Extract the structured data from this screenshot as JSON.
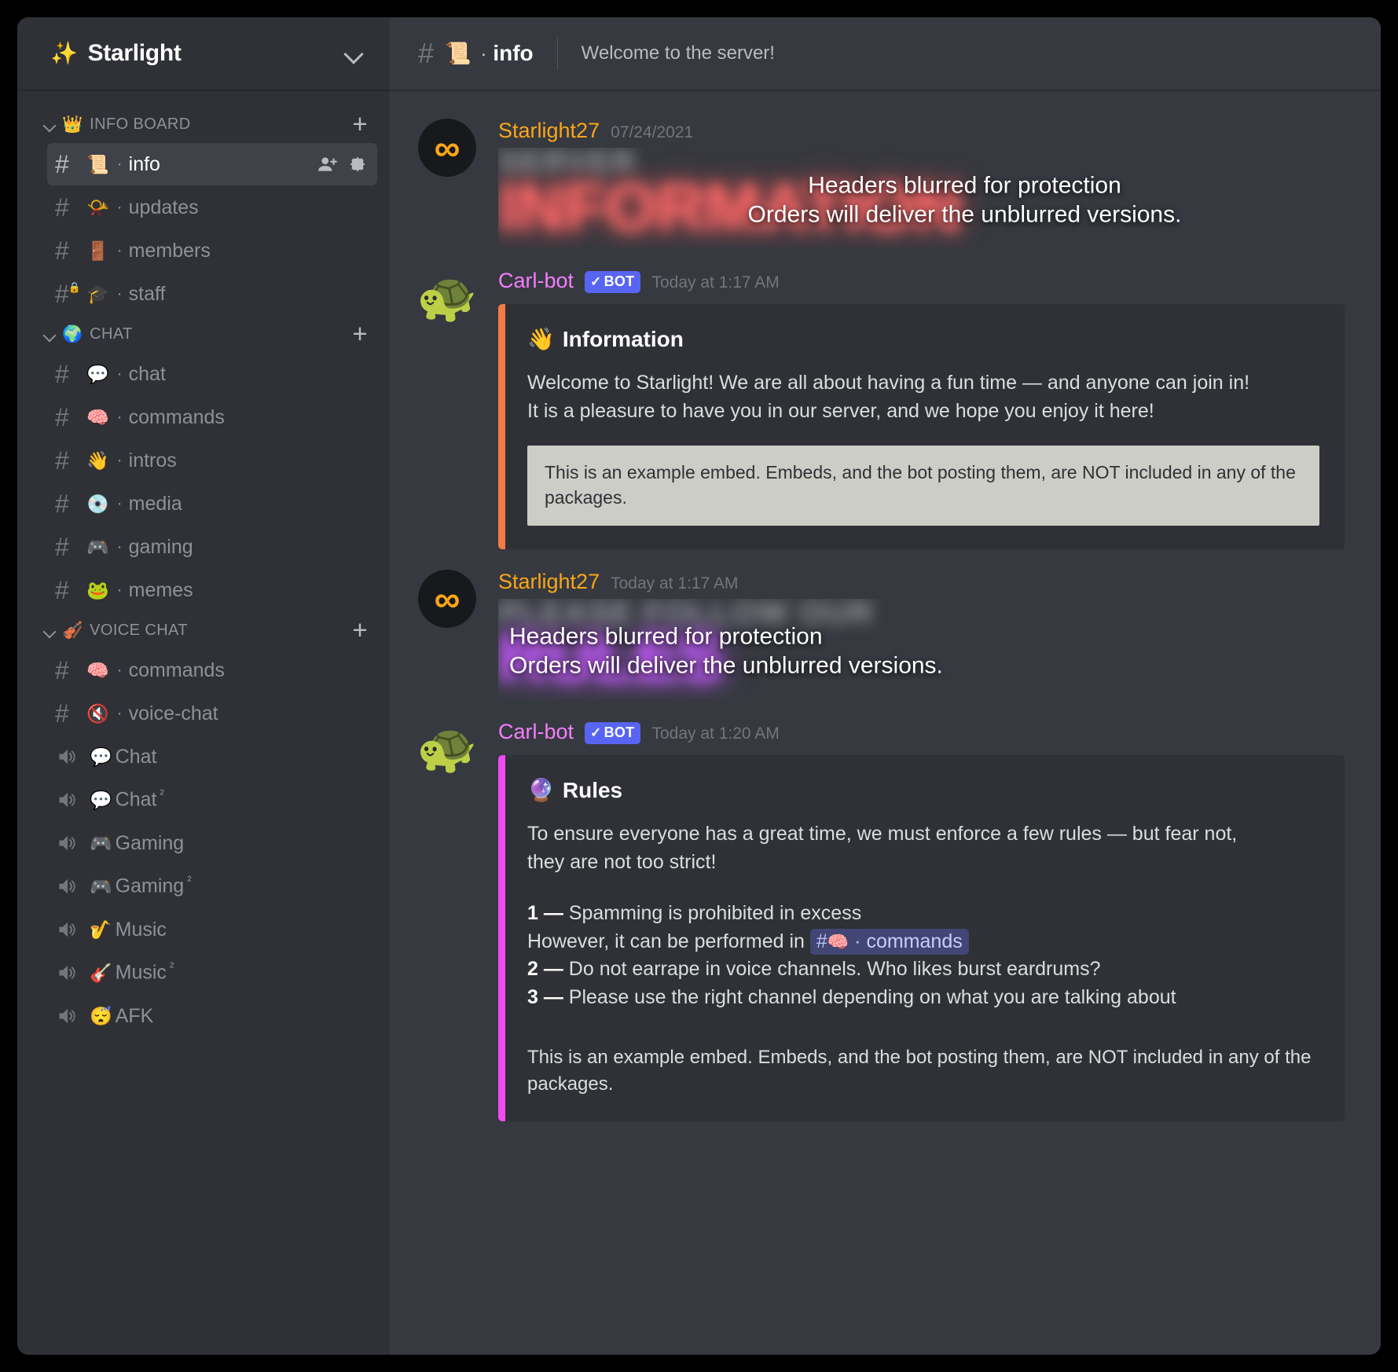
{
  "server": {
    "name": "Starlight",
    "emoji": "✨",
    "dropdown_icon": "chevron-down-icon"
  },
  "sidebar": {
    "categories": [
      {
        "label": "INFO BOARD",
        "emoji": "👑",
        "add_label": "+",
        "channels": [
          {
            "emoji": "📜",
            "name": "info",
            "type": "text",
            "active": true,
            "private": false,
            "sep": "·",
            "actions": [
              "add-member-icon",
              "settings-gear-icon"
            ]
          },
          {
            "emoji": "📯",
            "name": "updates",
            "type": "text",
            "active": false,
            "private": false,
            "sep": "·"
          },
          {
            "emoji": "🚪",
            "name": "members",
            "type": "text",
            "active": false,
            "private": false,
            "sep": "·"
          },
          {
            "emoji": "🎓",
            "name": "staff",
            "type": "text",
            "active": false,
            "private": true,
            "sep": "·"
          }
        ]
      },
      {
        "label": "CHAT",
        "emoji": "🌍",
        "add_label": "+",
        "channels": [
          {
            "emoji": "💬",
            "name": "chat",
            "type": "text",
            "active": false,
            "private": false,
            "sep": "·"
          },
          {
            "emoji": "🧠",
            "name": "commands",
            "type": "text",
            "active": false,
            "private": false,
            "sep": "·"
          },
          {
            "emoji": "👋",
            "name": "intros",
            "type": "text",
            "active": false,
            "private": false,
            "sep": "·"
          },
          {
            "emoji": "💿",
            "name": "media",
            "type": "text",
            "active": false,
            "private": false,
            "sep": "·"
          },
          {
            "emoji": "🎮",
            "name": "gaming",
            "type": "text",
            "active": false,
            "private": false,
            "sep": "·"
          },
          {
            "emoji": "🐸",
            "name": "memes",
            "type": "text",
            "active": false,
            "private": false,
            "sep": "·"
          }
        ]
      },
      {
        "label": "VOICE CHAT",
        "emoji": "🎻",
        "add_label": "+",
        "channels": [
          {
            "emoji": "🧠",
            "name": "commands",
            "type": "text",
            "active": false,
            "private": false,
            "sep": "·"
          },
          {
            "emoji": "🔇",
            "name": "voice‑chat",
            "type": "text",
            "active": false,
            "private": false,
            "sep": "·"
          },
          {
            "emoji": "💬",
            "name": "Chat",
            "type": "voice",
            "active": false,
            "sup": ""
          },
          {
            "emoji": "💬",
            "name": "Chat",
            "type": "voice",
            "active": false,
            "sup": "²"
          },
          {
            "emoji": "🎮",
            "name": "Gaming",
            "type": "voice",
            "active": false,
            "sup": ""
          },
          {
            "emoji": "🎮",
            "name": "Gaming",
            "type": "voice",
            "active": false,
            "sup": "²"
          },
          {
            "emoji": "🎷",
            "name": "Music",
            "type": "voice",
            "active": false,
            "sup": ""
          },
          {
            "emoji": "🎸",
            "name": "Music",
            "type": "voice",
            "active": false,
            "sup": "²"
          },
          {
            "emoji": "😴",
            "name": "AFK",
            "type": "voice",
            "active": false,
            "sup": ""
          }
        ]
      }
    ]
  },
  "channel_header": {
    "hash": "#",
    "emoji": "📜",
    "sep": "·",
    "name": "info",
    "topic": "Welcome to the server!"
  },
  "messages": [
    {
      "author": "Starlight27",
      "author_color": "#faa61a",
      "is_bot": false,
      "timestamp": "07/24/2021",
      "avatar_kind": "infinity-avatar",
      "avatar_glyph": "∞",
      "banner": {
        "sub_text": "SERVER",
        "main_text": "INFORMATION",
        "color_class": "red",
        "overlay_line1": "Headers blurred for protection",
        "overlay_line2": "Orders will deliver the unblurred versions."
      }
    },
    {
      "author": "Carl-bot",
      "author_color": "#f47fff",
      "is_bot": true,
      "bot_tag": "BOT",
      "bot_check": "✓",
      "timestamp": "Today at 1:17 AM",
      "avatar_kind": "turtle-avatar",
      "avatar_glyph": "🐢",
      "embed": {
        "accent_color": "#f37b46",
        "title_emoji": "👋",
        "title": "Information",
        "paragraphs": [
          "Welcome to Starlight! We are all about having a fun time — and anyone can join in!",
          "It is a pleasure to have you in our server, and we hope you enjoy it here!"
        ],
        "disclaimer": "This is an example embed. Embeds, and the bot posting them, are NOT included in any of the packages.",
        "disclaimer_style": "boxed"
      }
    },
    {
      "author": "Starlight27",
      "author_color": "#faa61a",
      "is_bot": false,
      "timestamp": "Today at 1:17 AM",
      "avatar_kind": "infinity-avatar",
      "avatar_glyph": "∞",
      "banner": {
        "sub_text": "PLEASE FOLLOW OUR",
        "main_text": "RULES",
        "color_class": "purple",
        "overlay_line1": "Headers blurred for protection",
        "overlay_line2": "Orders will deliver the unblurred versions."
      }
    },
    {
      "author": "Carl-bot",
      "author_color": "#f47fff",
      "is_bot": true,
      "bot_tag": "BOT",
      "bot_check": "✓",
      "timestamp": "Today at 1:20 AM",
      "avatar_kind": "turtle-avatar",
      "avatar_glyph": "🐢",
      "embed": {
        "accent_color": "#ef4cf0",
        "title_emoji": "🔮",
        "title": "Rules",
        "paragraphs": [
          "To ensure everyone has a great time, we must enforce a few rules — but fear not,",
          "they are not too strict!"
        ],
        "rules": [
          {
            "num": "1",
            "dash": "—",
            "text": "Spamming is prohibited in excess"
          },
          {
            "num": "",
            "dash": "",
            "text": "However, it can be performed in ",
            "mention": {
              "hash": "#",
              "emoji": "🧠",
              "sep": "·",
              "name": "commands"
            }
          },
          {
            "num": "2",
            "dash": "—",
            "text": "Do not earrape in voice channels. Who likes burst eardrums?"
          },
          {
            "num": "3",
            "dash": "—",
            "text": "Please use the right channel depending on what you are talking about"
          }
        ],
        "disclaimer": "This is an example embed. Embeds, and the bot posting them, are NOT included in any of the packages.",
        "disclaimer_style": "plain"
      }
    }
  ]
}
